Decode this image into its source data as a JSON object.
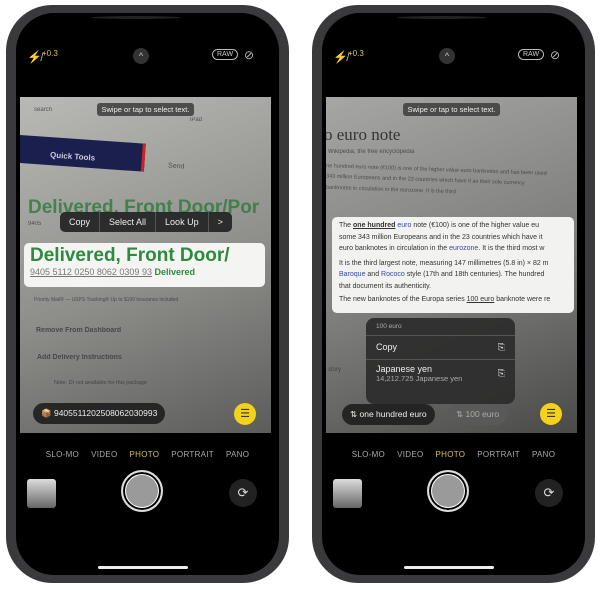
{
  "common": {
    "exposure": "+0.3",
    "raw": "RAW",
    "hint": "Swipe or tap to select text.",
    "modes": [
      "SLO-MO",
      "VIDEO",
      "PHOTO",
      "PORTRAIT",
      "PANO"
    ],
    "active_mode": "PHOTO",
    "accent": "#f4d21a"
  },
  "left": {
    "doc": {
      "search": "search",
      "ipad": "iPad",
      "quick_tools": "Quick Tools",
      "send": "Send",
      "bg_heading": "Delivered, Front Door/Por",
      "bg_num": "9405",
      "priority": "Priority Mail® — USPS Tracking® Up to $100 insurance included",
      "remove": "Remove From Dashboard",
      "add": "Add Delivery Instructions",
      "note": "Note: DI not available for this package"
    },
    "menu": {
      "copy": "Copy",
      "select_all": "Select All",
      "look_up": "Look Up",
      "more": ">"
    },
    "selection": {
      "heading": "Delivered, Front Door/",
      "tracking": "9405 5112 0250 8062 0309 93",
      "status": "Delivered"
    },
    "chip": "9405511202508062030993"
  },
  "right": {
    "doc": {
      "title": "o euro note",
      "subtitle": "Wikipedia, the free encyclopedia",
      "l1": "ne hundred euro note (€100) is one of the higher value euro banknotes and has been used",
      "l2": "343 million Europeans and in the 23 countries which have it as their sole currency",
      "l3": "banknotes in circulation in the eurozone. It is the third",
      "history": "story"
    },
    "selection": {
      "p1a": "The ",
      "p1b": "one hundred",
      "p1c": " euro",
      "p1d": " note (€100) is one of the higher value eu",
      "p2": "some 343 million Europeans and in the 23 countries which have it",
      "p3a": "euro banknotes in circulation in the ",
      "p3b": "eurozone",
      ".p3c": "",
      "p3d": ". It is the third most w",
      "p4": "It is the third largest note, measuring 147 millimetres (5.8 in) × 82 m",
      "p5a": "Baroque",
      "p5b": " and ",
      "p5c": "Rococo",
      "p5d": " style (17th and 18th centuries). The hundred",
      "p6": "that document its authenticity.",
      "p7a": "The new banknotes of the Europa series ",
      "p7b": "100 euro",
      "p7c": " banknote were re"
    },
    "menu": {
      "header": "100 euro",
      "copy": "Copy",
      "conv_label": "Japanese yen",
      "conv_value": "14,212.725 Japanese yen"
    },
    "chips": {
      "primary": "one hundred euro",
      "secondary": "100 euro"
    }
  }
}
